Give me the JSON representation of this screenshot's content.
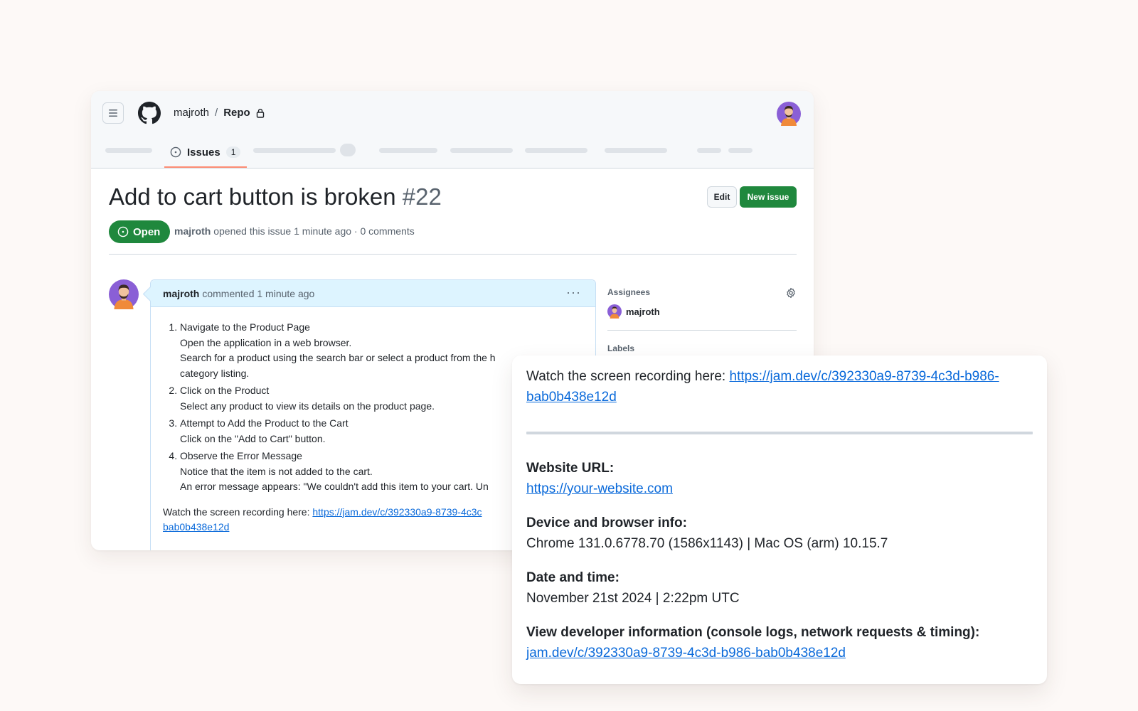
{
  "header": {
    "owner": "majroth",
    "separator": "/",
    "repo": "Repo",
    "tab_issues_label": "Issues",
    "tab_issues_count": "1"
  },
  "issue": {
    "title": "Add to cart button is broken",
    "number": "#22",
    "edit_label": "Edit",
    "new_issue_label": "New issue",
    "status": "Open",
    "author": "majroth",
    "meta_text": "opened this issue 1 minute ago · 0 comments"
  },
  "comment": {
    "author": "majroth",
    "action": "commented 1 minute ago",
    "kebab": "···",
    "steps": [
      {
        "title": "Navigate to the Product Page",
        "lines": [
          "Open the application in a web browser.",
          "Search for a product using the search bar or select a product from the h",
          "category listing."
        ]
      },
      {
        "title": "Click on the Product",
        "lines": [
          "Select any product to view its details on the product page."
        ]
      },
      {
        "title": "Attempt to Add the Product to the Cart",
        "lines": [
          "Click on the \"Add to Cart\" button."
        ]
      },
      {
        "title": "Observe the Error Message",
        "lines": [
          "Notice that the item is not added to the cart.",
          "An error message appears: \"We couldn't add this item to your cart. Un"
        ]
      }
    ],
    "recording_prefix": "Watch the screen recording here:",
    "recording_link_a": "https://jam.dev/c/392330a9-8739-4c3c",
    "recording_link_b": "bab0b438e12d"
  },
  "sidebar": {
    "assignees_heading": "Assignees",
    "assignee_name": "majroth",
    "labels_heading": "Labels"
  },
  "jam": {
    "recording_prefix": "Watch the screen recording here:",
    "recording_link": "https://jam.dev/c/392330a9-8739-4c3d-b986-bab0b438e12d",
    "url_label": "Website URL:",
    "url_value": "https://your-website.com",
    "device_label": "Device and browser info:",
    "device_value": "Chrome 131.0.6778.70 (1586x1143) | Mac OS (arm) 10.15.7",
    "date_label": "Date and time:",
    "date_value": "November 21st 2024 | 2:22pm UTC",
    "dev_label": "View developer information (console logs, network requests & timing):",
    "dev_link": "jam.dev/c/392330a9-8739-4c3d-b986-bab0b438e12d"
  },
  "colors": {
    "accent_green": "#1f883d",
    "link_blue": "#0969da",
    "tab_underline": "#fd8c73",
    "comment_header": "#ddf4ff"
  },
  "icons": [
    "hamburger-icon",
    "github-logo-icon",
    "lock-icon",
    "issue-opened-icon",
    "gear-icon",
    "kebab-icon",
    "avatar"
  ]
}
